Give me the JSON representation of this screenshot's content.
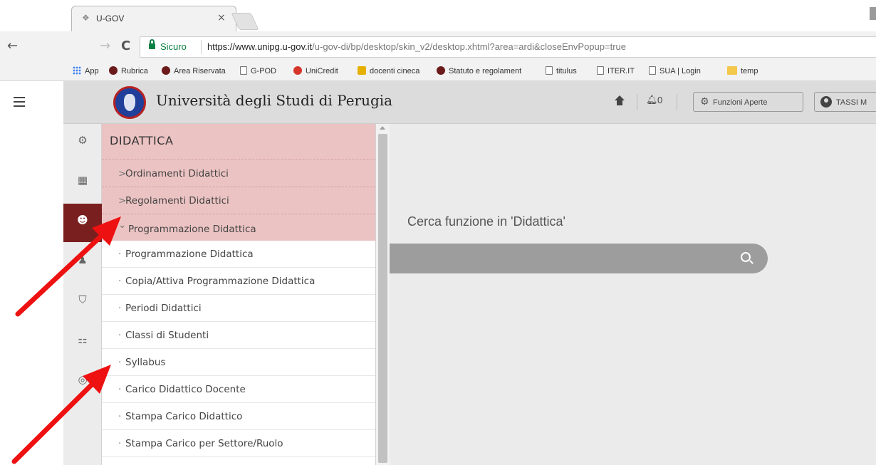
{
  "browser": {
    "tab": {
      "title": "U-GOV",
      "close": "×"
    },
    "nav": {
      "back": "←",
      "forward": "→",
      "reload": "C"
    },
    "url": {
      "secure_label": "Sicuro",
      "host": "https://www.unipg.u-gov.it",
      "path": "/u-gov-di/bp/desktop/skin_v2/desktop.xhtml?area=ardi&closeEnvPopup=true"
    },
    "bookmarks": [
      {
        "label": "App",
        "icon": "apps-grid-icon"
      },
      {
        "label": "Rubrica",
        "icon": "unipg-favicon-icon"
      },
      {
        "label": "Area Riservata",
        "icon": "unipg-favicon-icon"
      },
      {
        "label": "G-POD",
        "icon": "page-icon"
      },
      {
        "label": "UniCredit",
        "icon": "unicredit-favicon-icon"
      },
      {
        "label": "docenti cineca",
        "icon": "cineca-favicon-icon"
      },
      {
        "label": "Statuto e regolament",
        "icon": "unipg-favicon-icon"
      },
      {
        "label": "titulus",
        "icon": "page-icon"
      },
      {
        "label": "ITER.IT",
        "icon": "page-icon"
      },
      {
        "label": "SUA | Login",
        "icon": "page-icon"
      },
      {
        "label": "temp",
        "icon": "folder-icon"
      }
    ]
  },
  "header": {
    "university": "Università degli Studi di Perugia",
    "notifications_count": "0",
    "open_functions_label": "Funzioni Aperte",
    "user_label": "TASSI M"
  },
  "rail": {
    "items": [
      {
        "icon": "gears-icon",
        "glyph": "⚙",
        "active": false
      },
      {
        "icon": "chart-icon",
        "glyph": "📈",
        "active": false
      },
      {
        "icon": "head-icon",
        "glyph": "☻",
        "active": true
      },
      {
        "icon": "person-icon",
        "glyph": "♟",
        "active": false
      },
      {
        "icon": "shield-check-icon",
        "glyph": "⛉",
        "active": false
      },
      {
        "icon": "toggles-icon",
        "glyph": "⚏",
        "active": false
      },
      {
        "icon": "fingerprint-icon",
        "glyph": "◎",
        "active": false
      }
    ]
  },
  "menu": {
    "title": "DIDATTICA",
    "sections": [
      {
        "prefix": ">",
        "label": "Ordinamenti Didattici",
        "expanded": false
      },
      {
        "prefix": ">",
        "label": "Regolamenti Didattici",
        "expanded": false
      },
      {
        "prefix": "⌄",
        "label": "Programmazione Didattica",
        "expanded": true
      }
    ],
    "sub_items": [
      {
        "prefix": "·",
        "label": "Programmazione Didattica"
      },
      {
        "prefix": "·",
        "label": "Copia/Attiva Programmazione Didattica"
      },
      {
        "prefix": "·",
        "label": "Periodi Didattici"
      },
      {
        "prefix": "·",
        "label": "Classi di Studenti"
      },
      {
        "prefix": "·",
        "label": "Syllabus"
      },
      {
        "prefix": "·",
        "label": "Carico Didattico Docente"
      },
      {
        "prefix": "·",
        "label": "Stampa Carico Didattico"
      },
      {
        "prefix": "·",
        "label": "Stampa Carico per Settore/Ruolo"
      }
    ]
  },
  "main": {
    "search_label": "Cerca funzione in 'Didattica'",
    "search_value": ""
  },
  "colors": {
    "menu_highlight": "#ecc3c3",
    "rail_active": "#7a1f1f",
    "arrow": "#ee1111",
    "secure_green": "#0b8043"
  }
}
